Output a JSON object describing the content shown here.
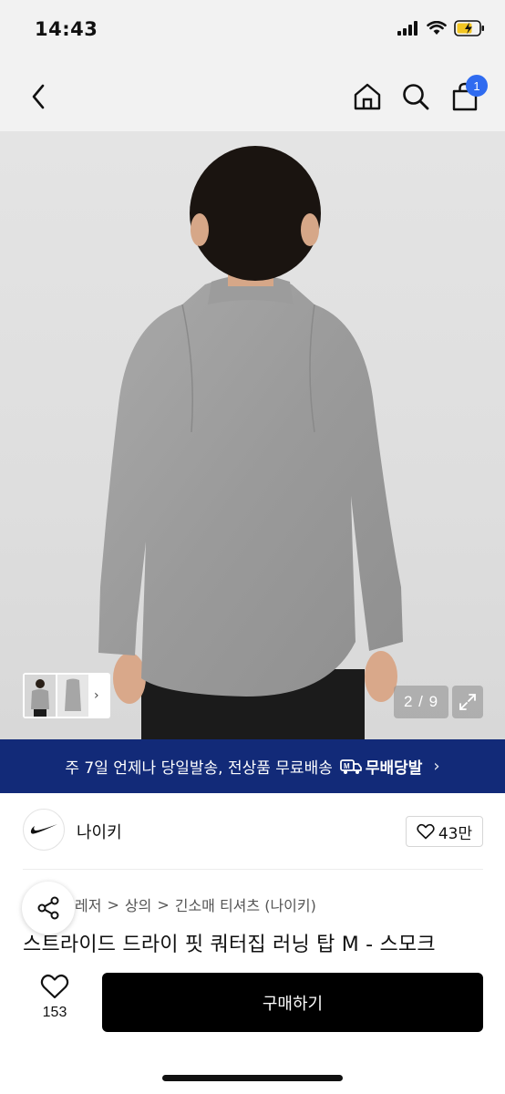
{
  "status": {
    "time": "14:43"
  },
  "nav": {
    "cart_count": "1"
  },
  "gallery": {
    "counter": "2 / 9"
  },
  "promo": {
    "text": "주 7일 언제나 당일발송, 전상품 무료배송",
    "brand": "무배당발"
  },
  "brand": {
    "name": "나이키",
    "likes": "43만"
  },
  "breadcrumb": {
    "items": [
      "레저",
      "상의",
      "긴소매 티셔츠 (나이키)"
    ]
  },
  "product": {
    "title": "스트라이드 드라이 핏 쿼터집 러닝 탑 M - 스모크"
  },
  "actions": {
    "wish_count": "153",
    "buy_label": "구매하기"
  },
  "colors": {
    "promo_bg": "#122a78",
    "badge": "#2f6bf0",
    "buy_bg": "#000000"
  }
}
